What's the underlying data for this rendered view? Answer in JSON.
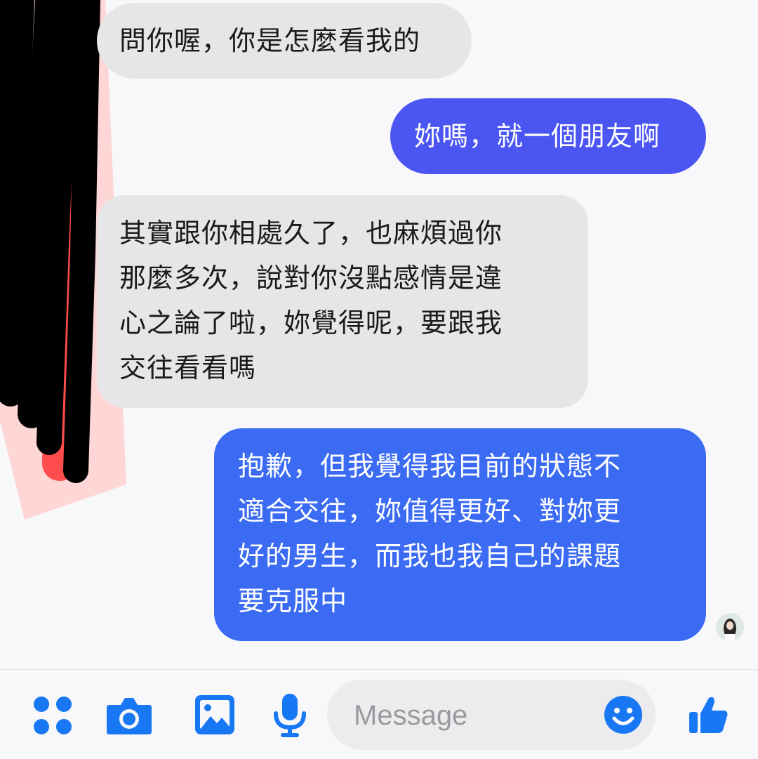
{
  "colors": {
    "incoming_bubble": "#e6e6e9",
    "outgoing_bubble_1": "#4a55f2",
    "outgoing_bubble_2": "#3b6bf3",
    "accent": "#1877f2",
    "redaction_black": "#000000",
    "redaction_red": "#ff4d4d"
  },
  "messages": [
    {
      "direction": "incoming",
      "text": "問你喔，你是怎麼看我的"
    },
    {
      "direction": "outgoing",
      "text": "妳嗎，就一個朋友啊"
    },
    {
      "direction": "incoming",
      "text": "其實跟你相處久了，也麻煩過你\n那麼多次，說對你沒點感情是違\n心之論了啦，妳覺得呢，要跟我\n交往看看嗎"
    },
    {
      "direction": "outgoing",
      "text": "抱歉，但我覺得我目前的狀態不\n適合交往，妳值得更好、對妳更\n好的男生，而我也我自己的課題\n要克服中"
    }
  ],
  "composer": {
    "placeholder": "Message",
    "icons": [
      "apps-grid-icon",
      "camera-icon",
      "image-icon",
      "microphone-icon",
      "emoji-icon",
      "thumbs-up-icon"
    ]
  }
}
